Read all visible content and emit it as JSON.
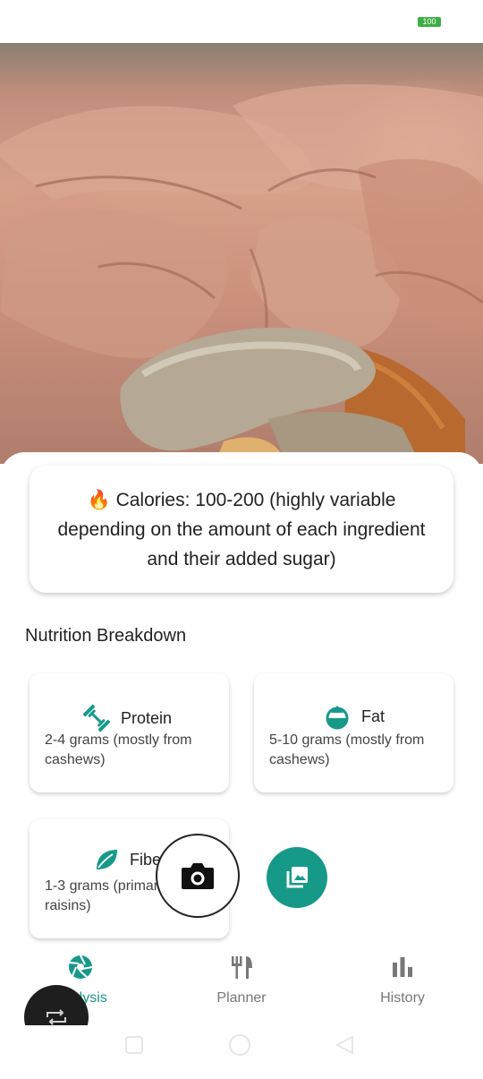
{
  "status_bar": {
    "battery": "100"
  },
  "calories": {
    "emoji": "🔥",
    "text": "Calories: 100-200 (highly variable depending on the amount of each ingredient and their added sugar)"
  },
  "breakdown": {
    "title": "Nutrition Breakdown",
    "items": [
      {
        "name": "Protein",
        "icon": "dumbbell-icon",
        "desc": "2-4 grams (mostly from cashews)"
      },
      {
        "name": "Fat",
        "icon": "water-drop-icon",
        "desc": "5-10 grams (mostly from cashews)"
      },
      {
        "name": "Fiber",
        "icon": "leaf-icon",
        "desc": "1-3 grams (primarily from raisins)"
      }
    ]
  },
  "actions": {
    "camera_icon": "camera-icon",
    "gallery_icon": "gallery-icon"
  },
  "nav": {
    "items": [
      {
        "label": "Analysis",
        "icon": "aperture-icon",
        "active": true
      },
      {
        "label": "Planner",
        "icon": "utensils-icon",
        "active": false
      },
      {
        "label": "History",
        "icon": "bar-chart-icon",
        "active": false
      }
    ]
  },
  "colors": {
    "accent": "#17998a",
    "text": "#222222",
    "muted": "#777777"
  }
}
